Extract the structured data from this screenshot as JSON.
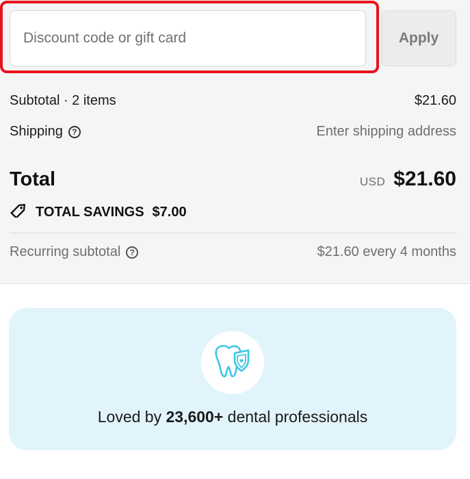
{
  "discount": {
    "placeholder": "Discount code or gift card",
    "value": "",
    "apply_label": "Apply"
  },
  "subtotal": {
    "label": "Subtotal · 2 items",
    "value": "$21.60"
  },
  "shipping": {
    "label": "Shipping",
    "value": "Enter shipping address"
  },
  "total": {
    "label": "Total",
    "currency": "USD",
    "value": "$21.60"
  },
  "savings": {
    "label": "TOTAL SAVINGS",
    "value": "$7.00"
  },
  "recurring": {
    "label": "Recurring subtotal",
    "value": "$21.60 every 4 months"
  },
  "promo": {
    "prefix": "Loved by",
    "count": "23,600+",
    "suffix": "dental professionals"
  },
  "colors": {
    "highlight": "#e8141c",
    "summary_bg": "#f5f5f5",
    "promo_bg": "#e1f4fc",
    "icon_accent": "#3cc7e3"
  },
  "icons": {
    "help": "question-circle-icon",
    "savings": "tag-icon",
    "promo": "tooth-shield-icon"
  }
}
